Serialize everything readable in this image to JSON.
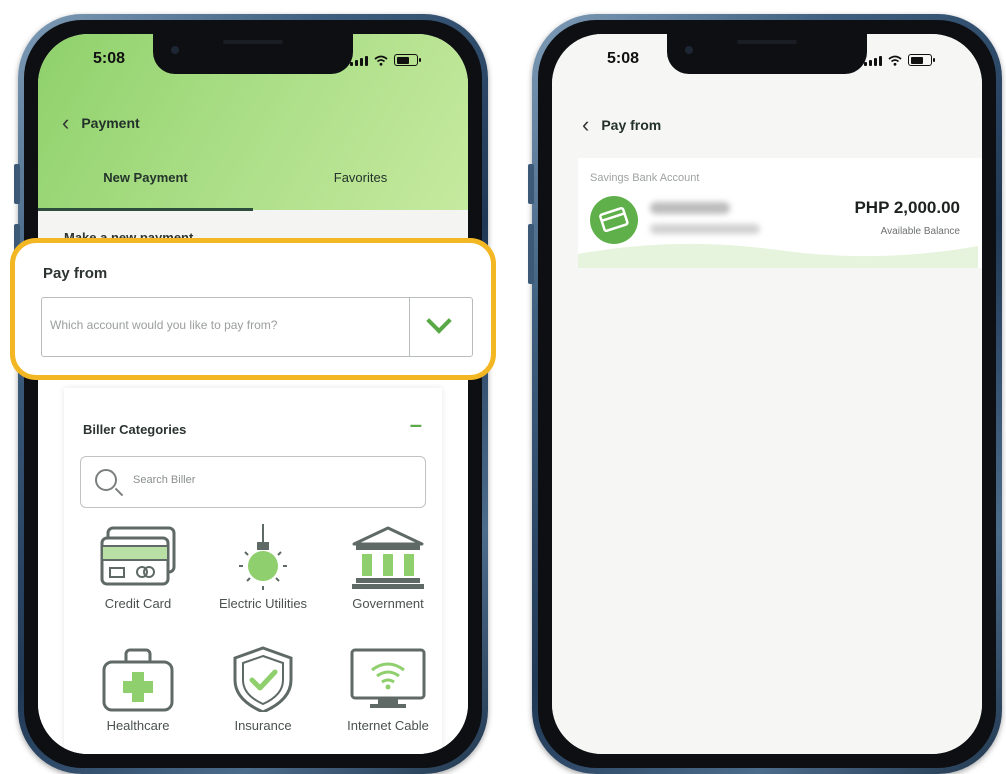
{
  "left_screen": {
    "time": "5:08",
    "nav_title": "Payment",
    "tabs": [
      {
        "label": "New Payment",
        "active": true
      },
      {
        "label": "Favorites",
        "active": false
      }
    ],
    "section_title": "Make a new payment",
    "pay_from": {
      "label": "Pay from",
      "placeholder": "Which account would you like to pay from?"
    },
    "biller": {
      "title": "Biller Categories",
      "collapse_symbol": "–",
      "search_placeholder": "Search Biller",
      "categories": [
        {
          "label": "Credit Card",
          "icon": "credit-card-icon"
        },
        {
          "label": "Electric Utilities",
          "icon": "light-bulb-icon"
        },
        {
          "label": "Government",
          "icon": "government-building-icon"
        },
        {
          "label": "Healthcare",
          "icon": "medical-kit-icon"
        },
        {
          "label": "Insurance",
          "icon": "shield-check-icon"
        },
        {
          "label": "Internet Cable",
          "icon": "monitor-wifi-icon"
        }
      ]
    }
  },
  "right_screen": {
    "time": "5:08",
    "nav_title": "Pay from",
    "account": {
      "type": "Savings Bank Account",
      "amount": "PHP 2,000.00",
      "balance_label": "Available Balance"
    }
  },
  "colors": {
    "accent_green": "#5da84a",
    "highlight": "#f2b722",
    "header_green_start": "#8fd16b",
    "header_green_end": "#c6ea9f"
  }
}
